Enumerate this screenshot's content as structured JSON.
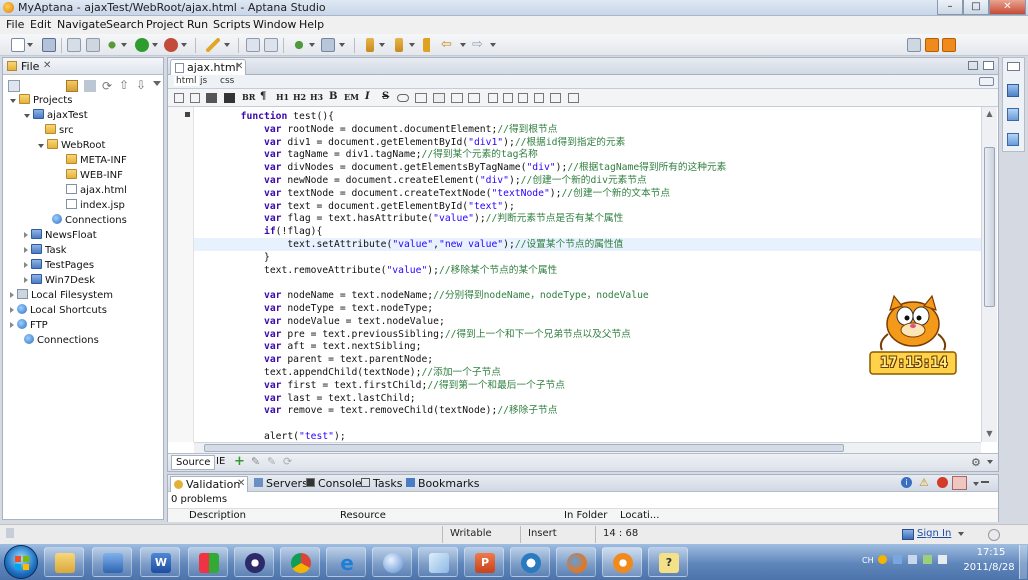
{
  "window": {
    "title": "MyAptana - ajaxTest/WebRoot/ajax.html - Aptana Studio",
    "minimize_glyph": "–",
    "maximize_glyph": "□",
    "close_glyph": "✕"
  },
  "menu": [
    "File",
    "Edit",
    "Navigate",
    "Search",
    "Project",
    "Run",
    "Scripts",
    "Window",
    "Help"
  ],
  "left_panel": {
    "tab_label": "File",
    "tree": [
      {
        "label": "Projects",
        "icon": "folder-icon"
      },
      {
        "label": "ajaxTest",
        "icon": "project-icon"
      },
      {
        "label": "src",
        "icon": "folder-icon"
      },
      {
        "label": "WebRoot",
        "icon": "folder-icon"
      },
      {
        "label": "META-INF",
        "icon": "folder-icon"
      },
      {
        "label": "WEB-INF",
        "icon": "folder-icon"
      },
      {
        "label": "ajax.html",
        "icon": "file-icon"
      },
      {
        "label": "index.jsp",
        "icon": "file-icon"
      },
      {
        "label": "Connections",
        "icon": "connections-icon"
      },
      {
        "label": "NewsFloat",
        "icon": "folder-icon"
      },
      {
        "label": "Task",
        "icon": "folder-icon"
      },
      {
        "label": "TestPages",
        "icon": "folder-icon"
      },
      {
        "label": "Win7Desk",
        "icon": "folder-icon"
      },
      {
        "label": "Local Filesystem",
        "icon": "drive-icon"
      },
      {
        "label": "Local Shortcuts",
        "icon": "globe-icon"
      },
      {
        "label": "FTP",
        "icon": "globe-icon"
      },
      {
        "label": "Connections",
        "icon": "connections-icon"
      }
    ]
  },
  "editor": {
    "tab_label": "ajax.html",
    "sub_tabs": [
      "html",
      "js",
      "css"
    ],
    "format_buttons": [
      "BR",
      "¶",
      "H1",
      "H2",
      "H3",
      "B",
      "EM",
      "I",
      "S"
    ],
    "bottom_tabs": [
      "Source",
      "IE"
    ],
    "lines": [
      [
        {
          "t": "        "
        },
        {
          "t": "function",
          "c": "kw"
        },
        {
          "t": " test(){"
        }
      ],
      [
        {
          "t": "            "
        },
        {
          "t": "var",
          "c": "kw"
        },
        {
          "t": " rootNode = document.documentElement;"
        },
        {
          "t": "//得到根节点",
          "c": "cm"
        }
      ],
      [
        {
          "t": "            "
        },
        {
          "t": "var",
          "c": "kw"
        },
        {
          "t": " div1 = document.getElementById("
        },
        {
          "t": "\"div1\"",
          "c": "st"
        },
        {
          "t": ");"
        },
        {
          "t": "//根据id得到指定的元素",
          "c": "cm"
        }
      ],
      [
        {
          "t": "            "
        },
        {
          "t": "var",
          "c": "kw"
        },
        {
          "t": " tagName = div1.tagName;"
        },
        {
          "t": "//得到某个元素的tag名称",
          "c": "cm"
        }
      ],
      [
        {
          "t": "            "
        },
        {
          "t": "var",
          "c": "kw"
        },
        {
          "t": " divNodes = document.getElementsByTagName("
        },
        {
          "t": "\"div\"",
          "c": "st"
        },
        {
          "t": ");"
        },
        {
          "t": "//根据tagName得到所有的这种元素",
          "c": "cm"
        }
      ],
      [
        {
          "t": "            "
        },
        {
          "t": "var",
          "c": "kw"
        },
        {
          "t": " newNode = document.createElement("
        },
        {
          "t": "\"div\"",
          "c": "st"
        },
        {
          "t": ");"
        },
        {
          "t": "//创建一个新的div元素节点",
          "c": "cm"
        }
      ],
      [
        {
          "t": "            "
        },
        {
          "t": "var",
          "c": "kw"
        },
        {
          "t": " textNode = document.createTextNode("
        },
        {
          "t": "\"textNode\"",
          "c": "st"
        },
        {
          "t": ");"
        },
        {
          "t": "//创建一个新的文本节点",
          "c": "cm"
        }
      ],
      [
        {
          "t": "            "
        },
        {
          "t": "var",
          "c": "kw"
        },
        {
          "t": " text = document.getElementById("
        },
        {
          "t": "\"text\"",
          "c": "st"
        },
        {
          "t": ");"
        }
      ],
      [
        {
          "t": "            "
        },
        {
          "t": "var",
          "c": "kw"
        },
        {
          "t": " flag = text.hasAttribute("
        },
        {
          "t": "\"value\"",
          "c": "st"
        },
        {
          "t": ");"
        },
        {
          "t": "//判断元素节点是否有某个属性",
          "c": "cm"
        }
      ],
      [
        {
          "t": "            "
        },
        {
          "t": "if",
          "c": "kw"
        },
        {
          "t": "(!flag){"
        }
      ],
      [
        {
          "t": "                text.setAttribute("
        },
        {
          "t": "\"value\"",
          "c": "st"
        },
        {
          "t": ","
        },
        {
          "t": "\"new value\"",
          "c": "st"
        },
        {
          "t": ");"
        },
        {
          "t": "//设置某个节点的属性值",
          "c": "cm"
        }
      ],
      [
        {
          "t": "            }"
        }
      ],
      [
        {
          "t": "            text.removeAttribute("
        },
        {
          "t": "\"value\"",
          "c": "st"
        },
        {
          "t": ");"
        },
        {
          "t": "//移除某个节点的某个属性",
          "c": "cm"
        }
      ],
      [
        {
          "t": ""
        }
      ],
      [
        {
          "t": "            "
        },
        {
          "t": "var",
          "c": "kw"
        },
        {
          "t": " nodeName = text.nodeName;"
        },
        {
          "t": "//分别得到nodeName，nodeType，nodeValue",
          "c": "cm"
        }
      ],
      [
        {
          "t": "            "
        },
        {
          "t": "var",
          "c": "kw"
        },
        {
          "t": " nodeType = text.nodeType;"
        }
      ],
      [
        {
          "t": "            "
        },
        {
          "t": "var",
          "c": "kw"
        },
        {
          "t": " nodeValue = text.nodeValue;"
        }
      ],
      [
        {
          "t": "            "
        },
        {
          "t": "var",
          "c": "kw"
        },
        {
          "t": " pre = text.previousSibling;"
        },
        {
          "t": "//得到上一个和下一个兄弟节点以及父节点",
          "c": "cm"
        }
      ],
      [
        {
          "t": "            "
        },
        {
          "t": "var",
          "c": "kw"
        },
        {
          "t": " aft = text.nextSibling;"
        }
      ],
      [
        {
          "t": "            "
        },
        {
          "t": "var",
          "c": "kw"
        },
        {
          "t": " parent = text.parentNode;"
        }
      ],
      [
        {
          "t": "            text.appendChild(textNode);"
        },
        {
          "t": "//添加一个子节点",
          "c": "cm"
        }
      ],
      [
        {
          "t": "            "
        },
        {
          "t": "var",
          "c": "kw"
        },
        {
          "t": " first = text.firstChild;"
        },
        {
          "t": "//得到第一个和最后一个子节点",
          "c": "cm"
        }
      ],
      [
        {
          "t": "            "
        },
        {
          "t": "var",
          "c": "kw"
        },
        {
          "t": " last = text.lastChild;"
        }
      ],
      [
        {
          "t": "            "
        },
        {
          "t": "var",
          "c": "kw"
        },
        {
          "t": " remove = text.removeChild(textNode);"
        },
        {
          "t": "//移除子节点",
          "c": "cm"
        }
      ],
      [
        {
          "t": ""
        }
      ],
      [
        {
          "t": "            alert("
        },
        {
          "t": "\"test\"",
          "c": "st"
        },
        {
          "t": ");"
        }
      ]
    ]
  },
  "bottom_panel": {
    "tabs": [
      "Validation",
      "Servers",
      "Console",
      "Tasks",
      "Bookmarks"
    ],
    "problems": "0 problems",
    "columns": [
      "Description",
      "Resource",
      "In Folder",
      "Locati..."
    ]
  },
  "status": {
    "writable": "Writable",
    "insert": "Insert",
    "position": "14 : 68",
    "sign_in": "Sign In"
  },
  "clock_widget": "17:15:14",
  "taskbar": {
    "lang": "CH",
    "time": "17:15",
    "date": "2011/8/28"
  },
  "colors": {
    "keyword": "#3b0aa8",
    "comment": "#2f7f3f",
    "string": "#2a00ff",
    "current_line": "#e8f2ff"
  }
}
